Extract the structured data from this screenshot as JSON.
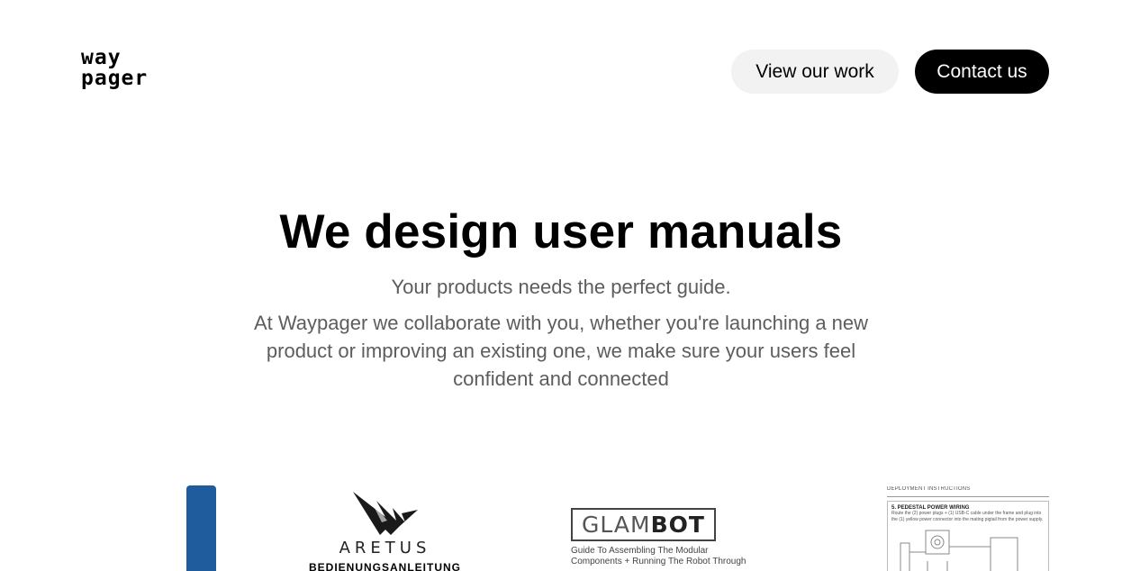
{
  "header": {
    "logo_line1": "way",
    "logo_line2": "pager",
    "nav": {
      "view_work_label": "View our work",
      "contact_label": "Contact us"
    }
  },
  "hero": {
    "title": "We design user manuals",
    "subtitle": "Your products needs the perfect guide.",
    "description": "At Waypager we collaborate with you, whether you're launching a new product or improving an existing one, we make sure your users feel confident and connected"
  },
  "gallery": {
    "aretus": {
      "name": "ARETUS",
      "subtitle": "BEDIENUNGSANLEITUNG"
    },
    "glambot": {
      "name_part1": "GLAM",
      "name_part2": "BOT",
      "line1": "Guide To Assembling The Modular",
      "line2": "Components + Running The Robot Through"
    },
    "deployment": {
      "header": "DEPLOYMENT INSTRUCTIONS",
      "section_title": "5. PEDESTAL POWER WIRING",
      "line1": "Route the (2) power plugs + (1) USB-C cable under the frame and plug into",
      "line2": "the (1) yellow power connector into the mating pigtail from the power supply."
    }
  },
  "colors": {
    "accent_blue": "#1f5c9e",
    "button_dark": "#000000",
    "button_light": "#f2f2f2",
    "text_muted": "#5d5d5d"
  }
}
